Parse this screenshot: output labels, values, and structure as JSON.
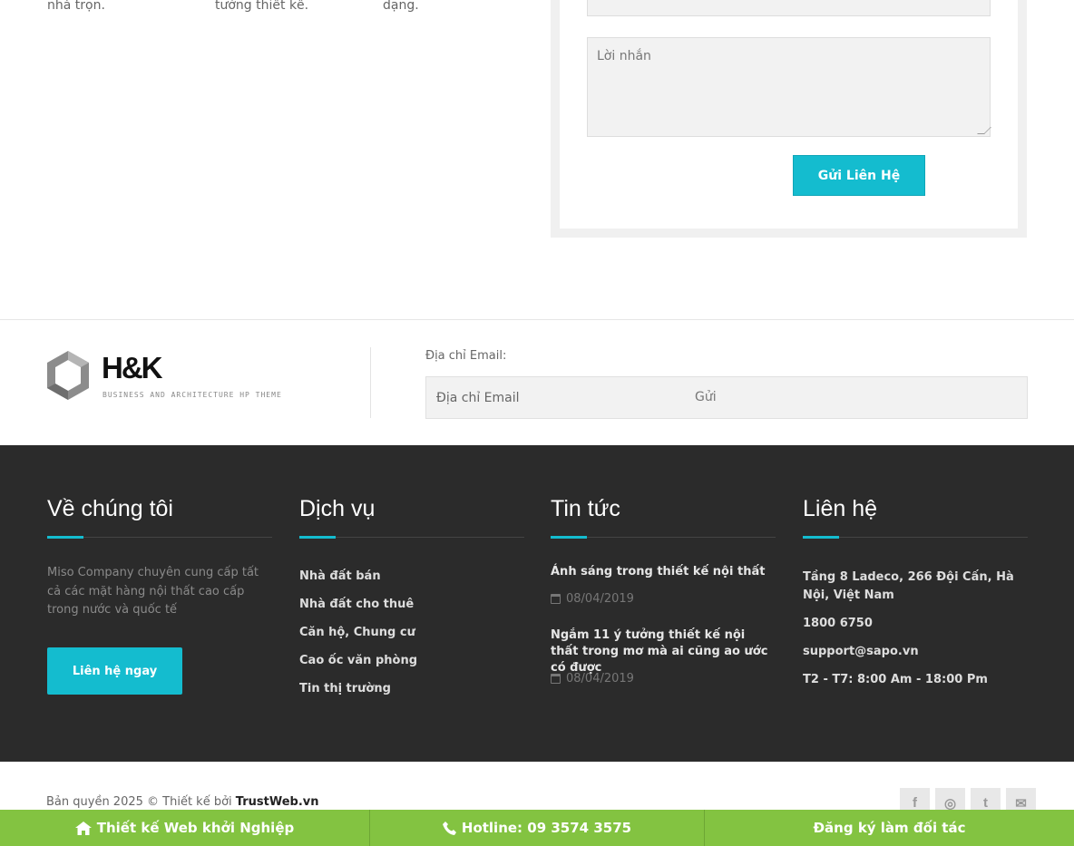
{
  "top_section": {
    "col_texts": [
      "nhà trọn.",
      "tưởng thiết kế.",
      "dạng."
    ],
    "message_placeholder": "Lời nhắn",
    "submit_label": "Gửi Liên Hệ"
  },
  "newsletter": {
    "logo_text": "H&K",
    "logo_tagline": "BUSINESS AND ARCHITECTURE HP THEME",
    "email_label": "Địa chỉ Email:",
    "email_placeholder": "Địa chỉ Email",
    "send_label": "Gửi"
  },
  "footer": {
    "about": {
      "title": "Về chúng tôi",
      "text": "Miso Company chuyên cung cấp tất cả các mặt hàng nội thất cao cấp trong nước và quốc tế",
      "cta_label": "Liên hệ ngay"
    },
    "services": {
      "title": "Dịch vụ",
      "links": [
        "Nhà đất bán",
        "Nhà đất cho thuê",
        "Căn hộ, Chung cư",
        "Cao ốc văn phòng",
        "Tin thị trường"
      ]
    },
    "news": {
      "title": "Tin tức",
      "items": [
        {
          "title": "Ánh sáng trong thiết kế nội thất",
          "date": "08/04/2019"
        },
        {
          "title": "Ngắm 11 ý tưởng thiết kế nội thất trong mơ mà ai cũng ao ước có được",
          "date": "08/04/2019"
        }
      ]
    },
    "contact": {
      "title": "Liên hệ",
      "address": "Tầng 8 Ladeco, 266 Đội Cấn, Hà Nội, Việt Nam",
      "phone": "1800 6750",
      "email": "support@sapo.vn",
      "hours": "T2 - T7: 8:00 Am - 18:00 Pm"
    }
  },
  "copyright": {
    "prefix": "Bản quyền 2025 © Thiết kế bởi",
    "brand": "TrustWeb.vn"
  },
  "socials": [
    {
      "icon": "facebook-icon",
      "glyph": "f"
    },
    {
      "icon": "instagram-icon",
      "glyph": "◎"
    },
    {
      "icon": "twitter-icon",
      "glyph": "t"
    },
    {
      "icon": "mail-icon",
      "glyph": "✉"
    }
  ],
  "bottom_bar": {
    "item1": "Thiết kế Web khởi Nghiệp",
    "item2": "Hotline: 09 3574 3575",
    "item3": "Đăng ký làm đối tác"
  },
  "colors": {
    "accent": "#14bccf",
    "footer_bg": "#2b2b2b",
    "bottom_bar": "#83c341"
  }
}
